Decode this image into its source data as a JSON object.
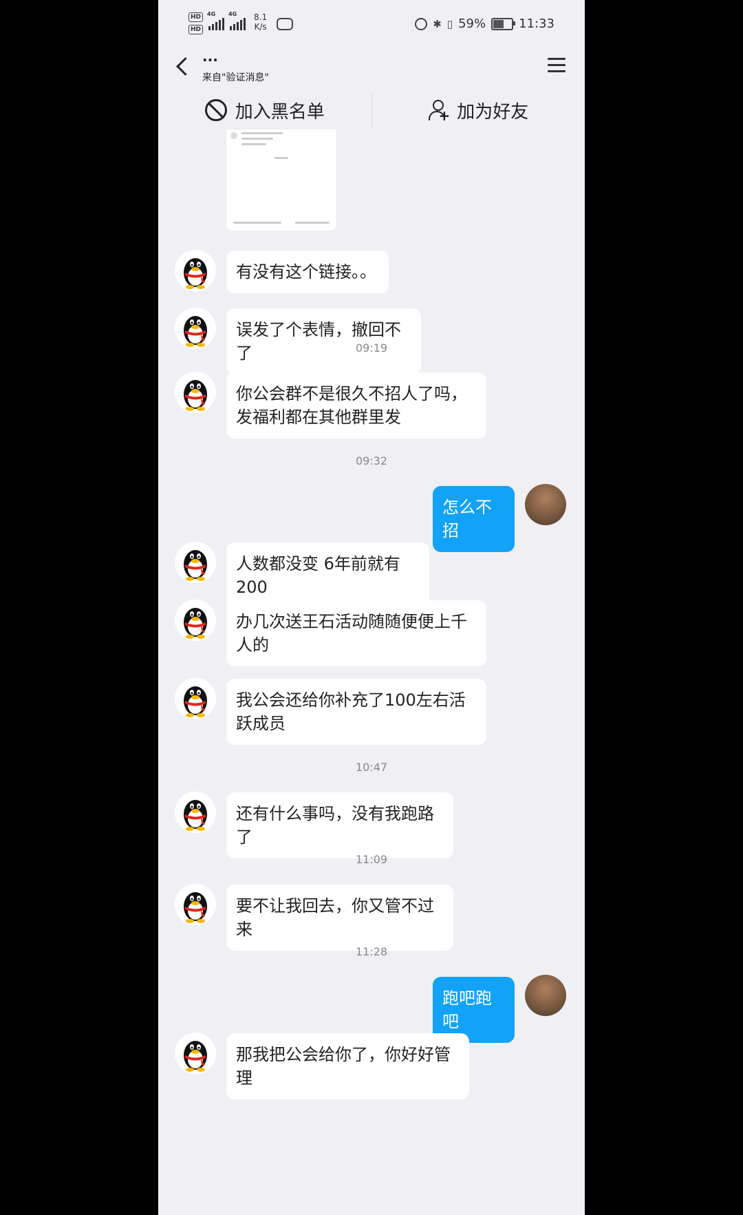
{
  "status_bar": {
    "hd_badges": [
      "HD",
      "HD"
    ],
    "net1": "4G",
    "net2": "4G",
    "net_speed_value": "8.1",
    "net_speed_unit": "K/s",
    "battery_pct": "59%",
    "battery_level": 0.59,
    "time": "11:33"
  },
  "header": {
    "name": "...",
    "subtitle": "来自\"验证消息\""
  },
  "actions": {
    "block_label": "加入黑名单",
    "add_friend_label": "加为好友"
  },
  "messages": [
    {
      "dir": "in",
      "text": "有没有这个链接。。"
    },
    {
      "dir": "in",
      "text": "误发了个表情，撤回不了"
    },
    {
      "time": "09:19"
    },
    {
      "dir": "in",
      "text": "你公会群不是很久不招人了吗，发福利都在其他群里发"
    },
    {
      "time": "09:32"
    },
    {
      "dir": "out",
      "text": "怎么不招"
    },
    {
      "dir": "in",
      "text": "人数都没变 6年前就有200"
    },
    {
      "dir": "in",
      "text": "办几次送王石活动随随便便上千人的"
    },
    {
      "dir": "in",
      "text": "我公会还给你补充了100左右活跃成员"
    },
    {
      "time": "10:47"
    },
    {
      "dir": "in",
      "text": "还有什么事吗，没有我跑路了"
    },
    {
      "time": "11:09"
    },
    {
      "dir": "in",
      "text": "要不让我回去，你又管不过来"
    },
    {
      "time": "11:28"
    },
    {
      "dir": "out",
      "text": "跑吧跑吧"
    },
    {
      "dir": "in",
      "text": "那我把公会给你了，你好好管理"
    }
  ],
  "colors": {
    "out_bubble": "#12a2f7",
    "in_bubble": "#ffffff",
    "background": "#f0f0f4"
  }
}
